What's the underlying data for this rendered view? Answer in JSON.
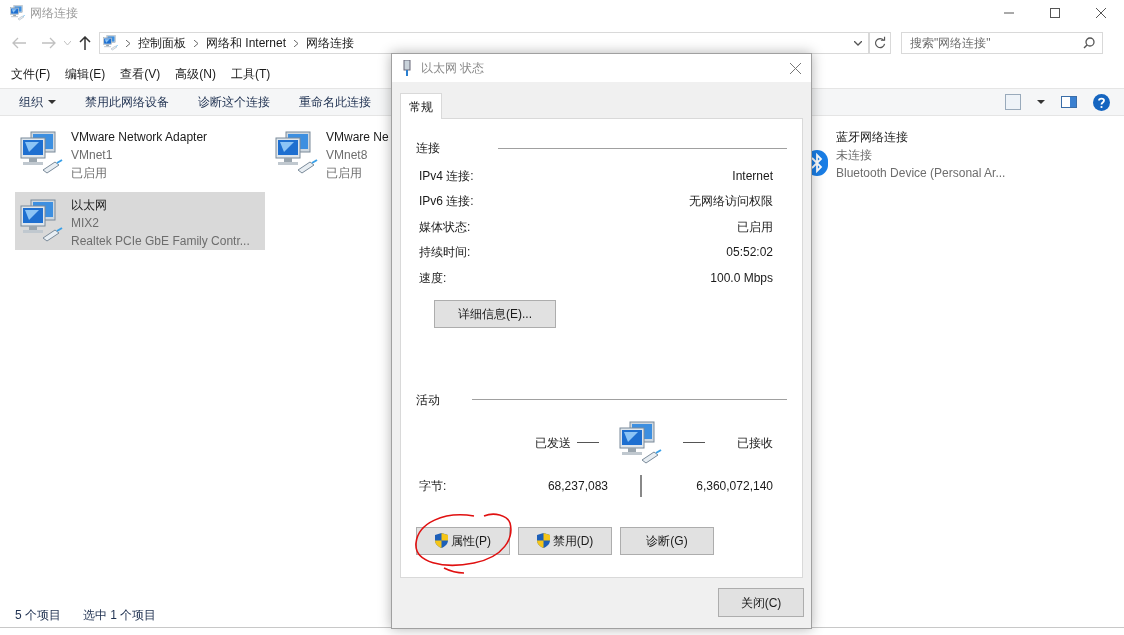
{
  "window": {
    "title": "网络连接"
  },
  "address": {
    "breadcrumbs": [
      "控制面板",
      "网络和 Internet",
      "网络连接"
    ],
    "search_placeholder": "搜索\"网络连接\""
  },
  "menu": [
    "文件(F)",
    "编辑(E)",
    "查看(V)",
    "高级(N)",
    "工具(T)"
  ],
  "toolbar": [
    {
      "label": "组织",
      "has_menu": true
    },
    {
      "label": "禁用此网络设备",
      "has_menu": false
    },
    {
      "label": "诊断这个连接",
      "has_menu": false
    },
    {
      "label": "重命名此连接",
      "has_menu": false
    }
  ],
  "adapters": [
    {
      "kind": "ethernet",
      "name": "VMware Network Adapter",
      "line2": "VMnet1",
      "line3": "已启用",
      "selected": false
    },
    {
      "kind": "ethernet",
      "name": "VMware Ne",
      "line2": "VMnet8",
      "line3": "已启用",
      "selected": false
    },
    {
      "kind": "hidden"
    },
    {
      "kind": "bluetooth",
      "name": "蓝牙网络连接",
      "line2": "未连接",
      "line3": "Bluetooth Device (Personal Ar...",
      "selected": false
    },
    {
      "kind": "ethernet",
      "name": "以太网",
      "line2": "MIX2",
      "line3": "Realtek PCIe GbE Family Contr...",
      "selected": true
    }
  ],
  "status_bar": [
    "5 个项目",
    "选中 1 个项目"
  ],
  "dialog": {
    "title": "以太网 状态",
    "tabs": [
      {
        "label": "常规",
        "selected": true
      }
    ],
    "connection": {
      "heading": "连接",
      "rows": [
        {
          "label": "IPv4 连接:",
          "value": "Internet"
        },
        {
          "label": "IPv6 连接:",
          "value": "无网络访问权限"
        },
        {
          "label": "媒体状态:",
          "value": "已启用"
        },
        {
          "label": "持续时间:",
          "value": "05:52:02"
        },
        {
          "label": "速度:",
          "value": "100.0 Mbps"
        }
      ],
      "details_button": "详细信息(E)..."
    },
    "activity": {
      "heading": "活动",
      "sent_label": "已发送",
      "received_label": "已接收",
      "bytes_label": "字节:",
      "sent": "68,237,083",
      "received": "6,360,072,140"
    },
    "buttons": [
      {
        "label": "属性(P)",
        "shield": true,
        "circled": true
      },
      {
        "label": "禁用(D)",
        "shield": true,
        "circled": false
      },
      {
        "label": "诊断(G)",
        "shield": false,
        "circled": false
      }
    ],
    "close_button": "关闭(C)"
  }
}
